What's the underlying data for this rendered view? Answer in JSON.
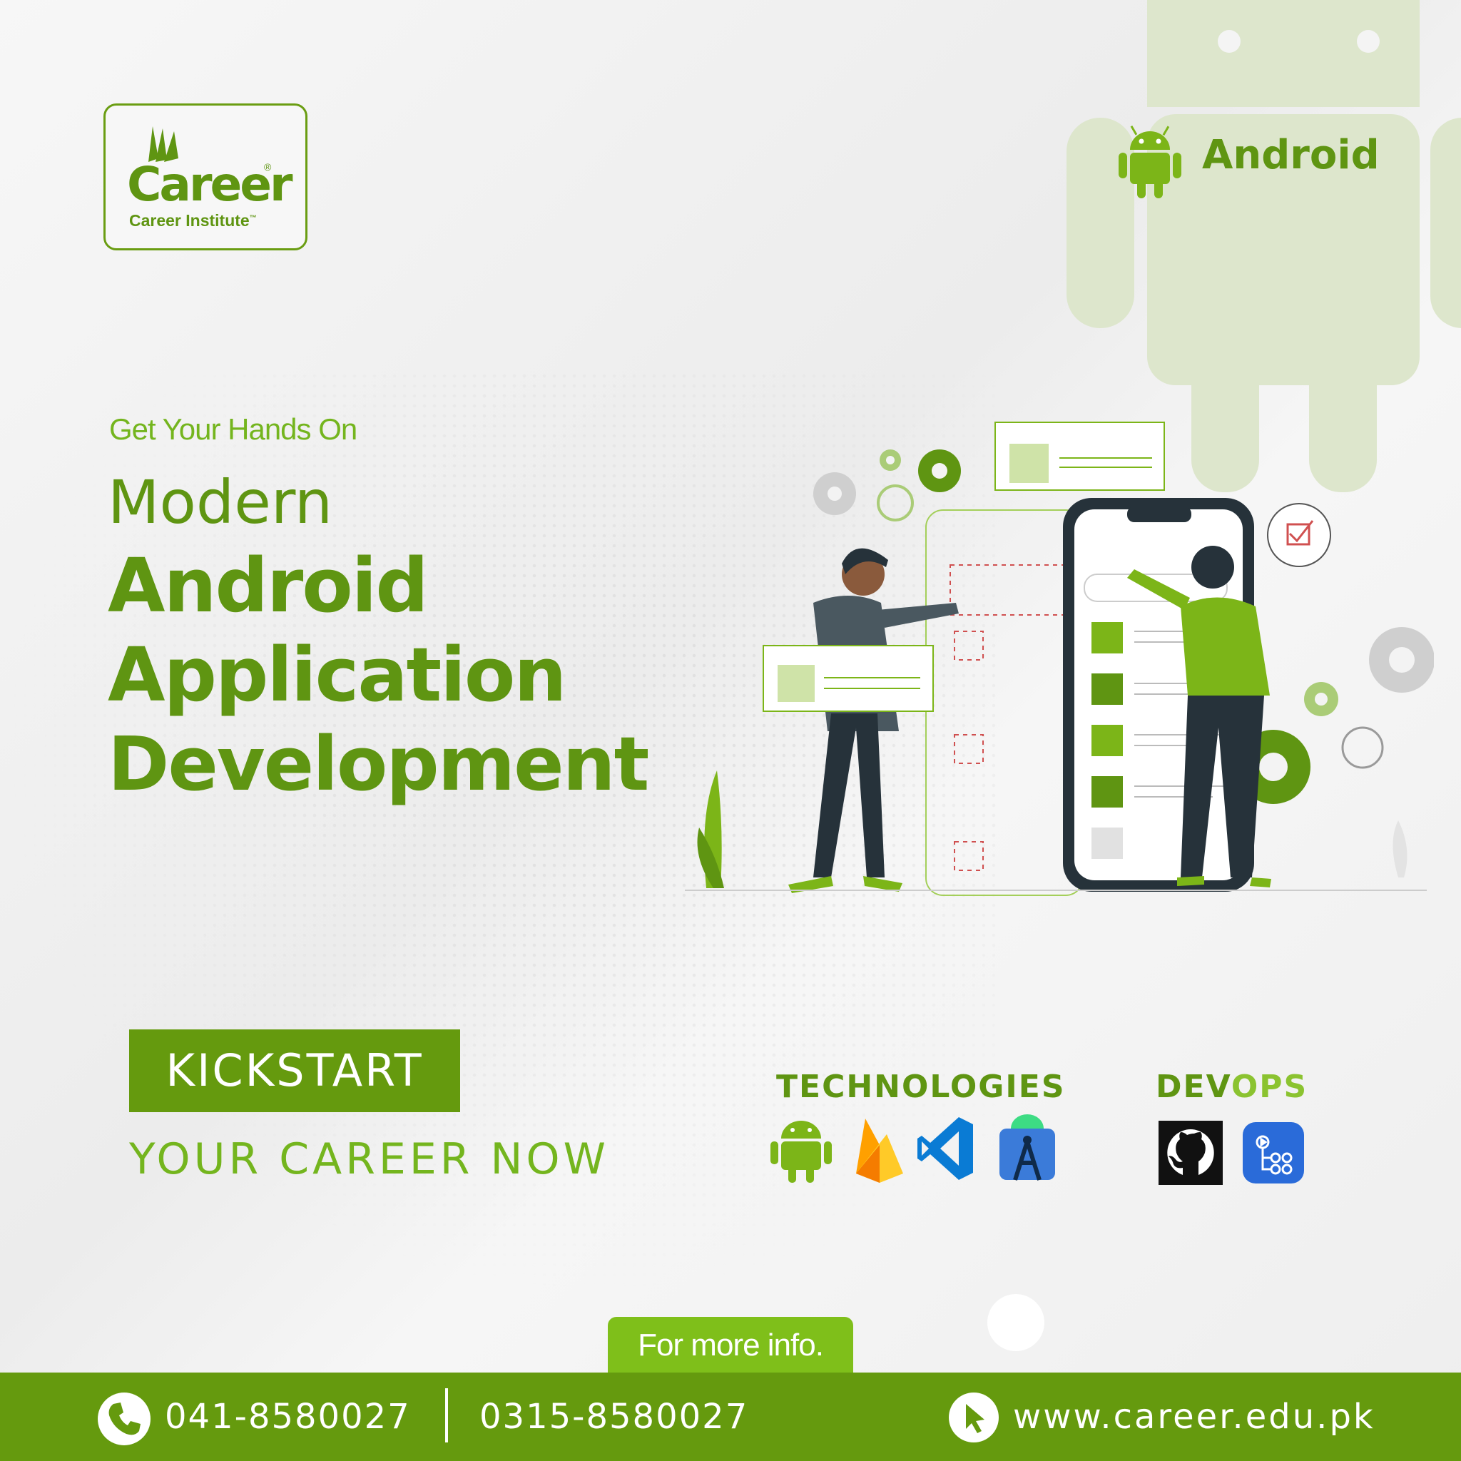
{
  "brand": {
    "logo_word": "Career",
    "logo_sub": "Career Institute",
    "trademark": "™",
    "registered": "®"
  },
  "badge": {
    "label": "Android",
    "icon": "android-icon"
  },
  "headline": {
    "kicker": "Get Your Hands On",
    "line1": "Modern",
    "line2": "Android",
    "line3": "Application",
    "line4": "Development"
  },
  "cta": {
    "button": "KICKSTART",
    "sub": "YOUR CAREER NOW"
  },
  "technologies": {
    "title": "TECHNOLOGIES",
    "icons": [
      "android-icon",
      "firebase-icon",
      "vscode-icon",
      "android-studio-icon"
    ]
  },
  "devops": {
    "title_part1": "DEV",
    "title_part2": "OPS",
    "icons": [
      "github-icon",
      "azure-pipelines-icon"
    ]
  },
  "more_info": "For more info.",
  "footer": {
    "phone1": "041-8580027",
    "phone2": "0315-8580027",
    "website": "www.career.edu.pk"
  },
  "colors": {
    "primary": "#659a0e",
    "light_green": "#74b51e",
    "android_green": "#7cb518",
    "background": "#f1f1f1"
  }
}
